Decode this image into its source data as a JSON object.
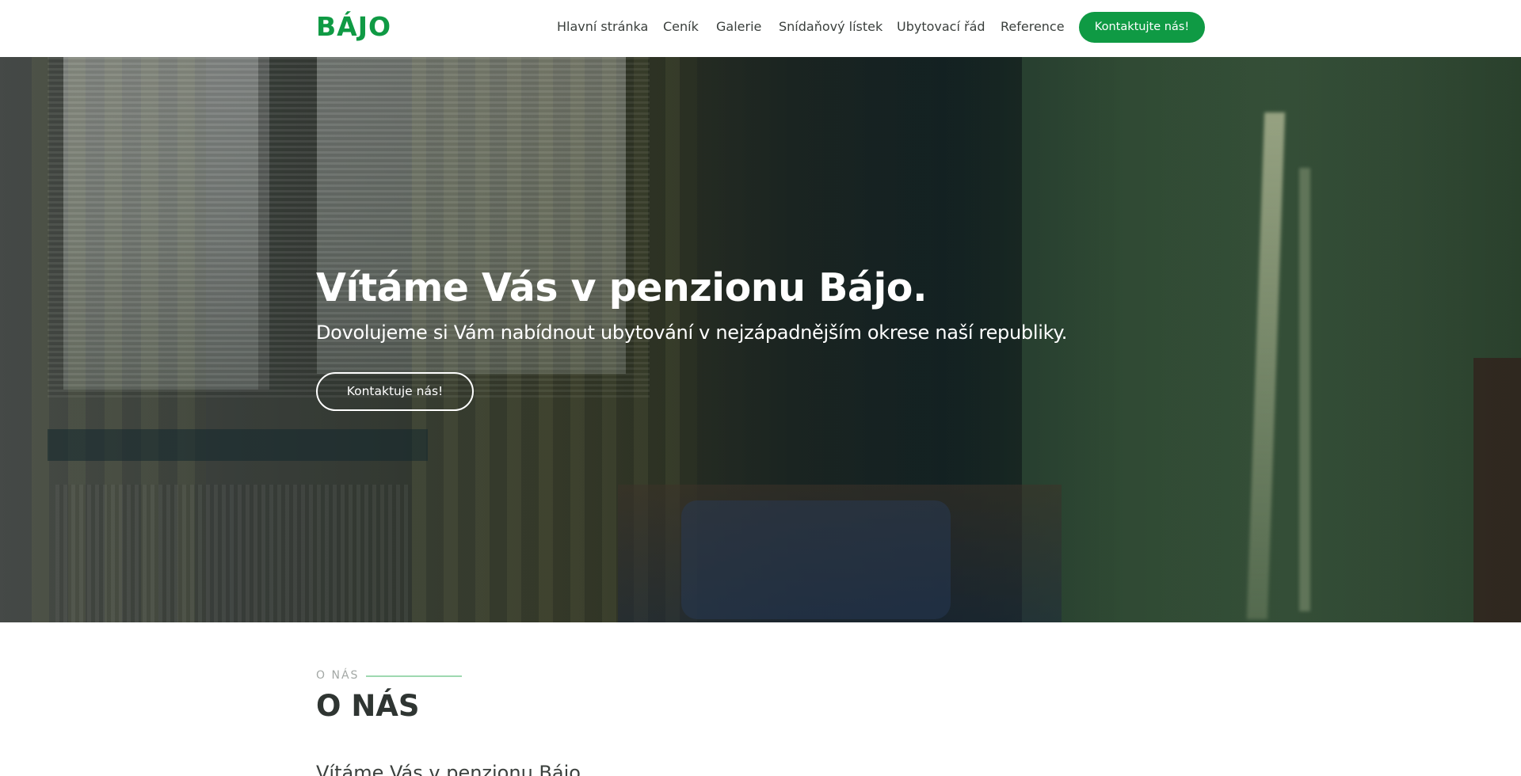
{
  "header": {
    "logo": "BÁJO",
    "nav": [
      {
        "label": "Hlavní stránka"
      },
      {
        "label": "Ceník"
      },
      {
        "label": "Galerie"
      },
      {
        "label": "Snídaňový lístek"
      },
      {
        "label": "Ubytovací řád"
      },
      {
        "label": "Reference"
      }
    ],
    "cta_label": "Kontaktujte nás!"
  },
  "hero": {
    "title": "Vítáme Vás v penzionu Bájo.",
    "subtitle": "Dovolujeme si Vám nabídnout ubytování v nejzápadnějším okrese naší republiky.",
    "button_label": "Kontaktuje nás!"
  },
  "about": {
    "kicker": "O NÁS",
    "title": "O NÁS",
    "text": "Vítáme Vás v penzionu Bájo"
  },
  "colors": {
    "brand_green": "#0f9a44",
    "accent_line": "#9ed8b0"
  }
}
